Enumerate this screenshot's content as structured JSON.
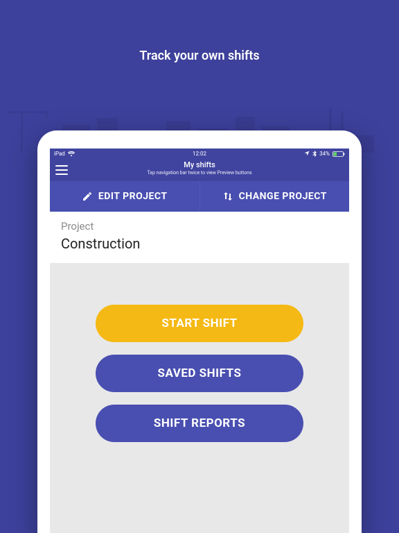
{
  "promo": {
    "tagline": "Track your own shifts"
  },
  "statusbar": {
    "device": "iPad",
    "time": "12:02",
    "battery_pct": "34%"
  },
  "navbar": {
    "title": "My shifts",
    "subtitle": "Tap navigation bar twice to view Preview buttons"
  },
  "actionbar": {
    "edit_label": "EDIT PROJECT",
    "change_label": "CHANGE PROJECT"
  },
  "project": {
    "label": "Project",
    "value": "Construction"
  },
  "buttons": {
    "start": "START SHIFT",
    "saved": "SAVED SHIFTS",
    "reports": "SHIFT REPORTS"
  },
  "colors": {
    "brand_bg": "#3d419b",
    "nav_bg": "#40449f",
    "action_bg": "#494fb0",
    "pill_yellow": "#f5b915",
    "pill_blue": "#494fb0"
  }
}
